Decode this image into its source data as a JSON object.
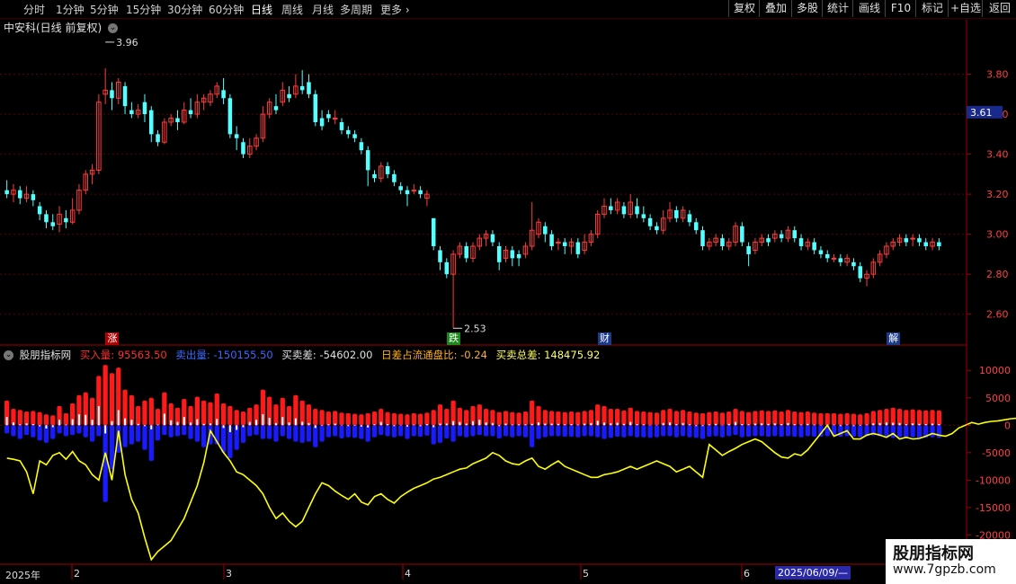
{
  "toolbar": {
    "periods": [
      "分时",
      "1分钟",
      "5分钟",
      "15分钟",
      "30分钟",
      "60分钟",
      "日线",
      "周线",
      "月线",
      "多周期",
      "更多"
    ],
    "active_period": "日线",
    "right_buttons": [
      "复权",
      "叠加",
      "多股",
      "统计",
      "画线",
      "F10",
      "标记",
      "+自选",
      "返回"
    ]
  },
  "chart_header": {
    "title": "中安科(日线 前复权)"
  },
  "price_axis": {
    "ticks": [
      "3.80",
      "3.60",
      "3.40",
      "3.20",
      "3.00",
      "2.80",
      "2.60"
    ],
    "current_price": "3.61"
  },
  "annotations": {
    "high": "3.96",
    "low": "2.53"
  },
  "event_labels": [
    {
      "text": "涨",
      "color": "#b00000",
      "index": 16
    },
    {
      "text": "跌",
      "color": "#1a8a1a",
      "index": 68
    },
    {
      "text": "财",
      "color": "#1a3a8a",
      "index": 91
    },
    {
      "text": "解",
      "color": "#1a3a8a",
      "index": 135
    }
  ],
  "indicator": {
    "name": "股朋指标网",
    "buy_label": "买入量: 95563.50",
    "sell_label": "卖出量: -150155.50",
    "diff_label": "买卖差: -54602.00",
    "ratio_label": "日差占流通盘比: -0.24",
    "total_label": "买卖总差: 148475.92",
    "axis_ticks": [
      "10000",
      "5000",
      "0",
      "-5000",
      "-10000",
      "-15000",
      "-20000"
    ]
  },
  "date_axis": {
    "labels": [
      "2025年",
      "2",
      "3",
      "4",
      "5",
      "6"
    ],
    "cursor_date": "2025/06/09/—"
  },
  "watermark": {
    "title": "股朋指标网",
    "url": "www.7gpzb.com"
  },
  "colors": {
    "up": "#ff3c3c",
    "down": "#54ffff",
    "buy": "#ff1a1a",
    "sell": "#1a1aff",
    "line": "#ffff00",
    "grid": "#5a0000"
  },
  "chart_data": {
    "type": "candlestick",
    "price_ylim": [
      2.5,
      4.0
    ],
    "indicator_ylim": [
      -25000,
      12000
    ],
    "candles": [
      [
        3.22,
        3.2,
        3.27,
        3.18,
        4500,
        -1500
      ],
      [
        3.2,
        3.22,
        3.25,
        3.16,
        3000,
        -2000
      ],
      [
        3.22,
        3.18,
        3.24,
        3.15,
        2800,
        -2500
      ],
      [
        3.18,
        3.2,
        3.24,
        3.16,
        2500,
        -1800
      ],
      [
        3.2,
        3.17,
        3.22,
        3.14,
        2600,
        -2200
      ],
      [
        3.14,
        3.1,
        3.16,
        3.07,
        2400,
        -2800
      ],
      [
        3.1,
        3.06,
        3.12,
        3.03,
        2000,
        -3200
      ],
      [
        3.06,
        3.04,
        3.1,
        3.02,
        1800,
        -2500
      ],
      [
        3.05,
        3.1,
        3.14,
        3.01,
        3500,
        -1500
      ],
      [
        3.08,
        3.06,
        3.12,
        3.03,
        2200,
        -2000
      ],
      [
        3.06,
        3.12,
        3.18,
        3.05,
        4000,
        -1800
      ],
      [
        3.12,
        3.22,
        3.25,
        3.1,
        5500,
        -1500
      ],
      [
        3.22,
        3.3,
        3.32,
        3.2,
        6000,
        -2200
      ],
      [
        3.3,
        3.32,
        3.35,
        3.25,
        5000,
        -3000
      ],
      [
        3.32,
        3.66,
        3.7,
        3.3,
        9000,
        -2000
      ],
      [
        3.7,
        3.72,
        3.83,
        3.65,
        11000,
        -14000
      ],
      [
        3.72,
        3.68,
        3.76,
        3.62,
        9500,
        -8000
      ],
      [
        3.68,
        3.76,
        3.78,
        3.65,
        10500,
        -5000
      ],
      [
        3.74,
        3.64,
        3.76,
        3.6,
        6500,
        -4000
      ],
      [
        3.62,
        3.6,
        3.66,
        3.58,
        5500,
        -3500
      ],
      [
        3.6,
        3.62,
        3.65,
        3.58,
        3500,
        -3000
      ],
      [
        3.66,
        3.6,
        3.7,
        3.56,
        4500,
        -4500
      ],
      [
        3.62,
        3.5,
        3.64,
        3.46,
        5000,
        -6500
      ],
      [
        3.5,
        3.46,
        3.52,
        3.44,
        3000,
        -2800
      ],
      [
        3.46,
        3.56,
        3.58,
        3.45,
        6000,
        -1800
      ],
      [
        3.56,
        3.58,
        3.6,
        3.54,
        4000,
        -2200
      ],
      [
        3.58,
        3.56,
        3.62,
        3.52,
        3200,
        -2000
      ],
      [
        3.56,
        3.62,
        3.66,
        3.55,
        4800,
        -1800
      ],
      [
        3.62,
        3.6,
        3.68,
        3.58,
        3500,
        -2500
      ],
      [
        3.6,
        3.66,
        3.7,
        3.58,
        5200,
        -3000
      ],
      [
        3.66,
        3.68,
        3.7,
        3.62,
        4500,
        -4000
      ],
      [
        3.66,
        3.7,
        3.72,
        3.64,
        4200,
        -3500
      ],
      [
        3.7,
        3.74,
        3.76,
        3.68,
        5800,
        -3500
      ],
      [
        3.72,
        3.68,
        3.78,
        3.65,
        4000,
        -5000
      ],
      [
        3.68,
        3.5,
        3.7,
        3.48,
        3500,
        -6000
      ],
      [
        3.5,
        3.48,
        3.54,
        3.42,
        2800,
        -4500
      ],
      [
        3.46,
        3.4,
        3.48,
        3.38,
        2500,
        -3200
      ],
      [
        3.4,
        3.44,
        3.48,
        3.38,
        3200,
        -2000
      ],
      [
        3.44,
        3.48,
        3.5,
        3.42,
        3800,
        -1800
      ],
      [
        3.48,
        3.6,
        3.64,
        3.46,
        6500,
        -2500
      ],
      [
        3.6,
        3.66,
        3.68,
        3.58,
        5200,
        -2500
      ],
      [
        3.64,
        3.62,
        3.7,
        3.6,
        3800,
        -3000
      ],
      [
        3.66,
        3.72,
        3.76,
        3.64,
        5000,
        -2000
      ],
      [
        3.7,
        3.68,
        3.74,
        3.66,
        3500,
        -2500
      ],
      [
        3.7,
        3.74,
        3.8,
        3.68,
        5500,
        -3000
      ],
      [
        3.74,
        3.72,
        3.82,
        3.7,
        4500,
        -3200
      ],
      [
        3.76,
        3.7,
        3.8,
        3.68,
        3800,
        -3000
      ],
      [
        3.7,
        3.56,
        3.72,
        3.54,
        3000,
        -4000
      ],
      [
        3.58,
        3.54,
        3.62,
        3.52,
        2800,
        -3000
      ],
      [
        3.6,
        3.58,
        3.62,
        3.56,
        2500,
        -2200
      ],
      [
        3.58,
        3.58,
        3.62,
        3.55,
        2600,
        -2000
      ],
      [
        3.56,
        3.52,
        3.58,
        3.5,
        2300,
        -2400
      ],
      [
        3.52,
        3.5,
        3.54,
        3.48,
        2200,
        -2200
      ],
      [
        3.5,
        3.48,
        3.52,
        3.46,
        2100,
        -2300
      ],
      [
        3.46,
        3.42,
        3.48,
        3.4,
        2000,
        -2500
      ],
      [
        3.42,
        3.32,
        3.44,
        3.24,
        2200,
        -3000
      ],
      [
        3.3,
        3.28,
        3.32,
        3.26,
        2500,
        -2200
      ],
      [
        3.28,
        3.34,
        3.36,
        3.26,
        3000,
        -1800
      ],
      [
        3.34,
        3.3,
        3.36,
        3.28,
        2400,
        -2000
      ],
      [
        3.3,
        3.26,
        3.32,
        3.24,
        2200,
        -2200
      ],
      [
        3.24,
        3.22,
        3.26,
        3.2,
        2100,
        -2000
      ],
      [
        3.22,
        3.2,
        3.24,
        3.14,
        2000,
        -2500
      ],
      [
        3.22,
        3.22,
        3.25,
        3.2,
        2200,
        -2000
      ],
      [
        3.22,
        3.2,
        3.24,
        3.18,
        2100,
        -2100
      ],
      [
        3.18,
        3.2,
        3.22,
        3.14,
        2300,
        -1900
      ],
      [
        3.08,
        2.94,
        3.08,
        2.92,
        2800,
        -3500
      ],
      [
        2.92,
        2.86,
        2.94,
        2.82,
        3800,
        -3200
      ],
      [
        2.86,
        2.8,
        2.88,
        2.78,
        3000,
        -2400
      ],
      [
        2.8,
        2.9,
        2.92,
        2.53,
        4500,
        -3000
      ],
      [
        2.9,
        2.94,
        2.96,
        2.88,
        3200,
        -2000
      ],
      [
        2.94,
        2.88,
        2.96,
        2.86,
        2800,
        -2200
      ],
      [
        2.88,
        2.94,
        2.96,
        2.86,
        3500,
        -2000
      ],
      [
        2.94,
        2.98,
        3.0,
        2.92,
        3800,
        -1800
      ],
      [
        2.98,
        3.0,
        3.02,
        2.94,
        3000,
        -2000
      ],
      [
        3.0,
        2.96,
        3.02,
        2.94,
        2800,
        -2000
      ],
      [
        2.94,
        2.86,
        2.96,
        2.82,
        2400,
        -2400
      ],
      [
        2.88,
        2.92,
        2.94,
        2.86,
        2600,
        -2000
      ],
      [
        2.92,
        2.88,
        2.94,
        2.84,
        2400,
        -2200
      ],
      [
        2.9,
        2.88,
        2.92,
        2.84,
        2300,
        -2000
      ],
      [
        2.9,
        2.94,
        2.96,
        2.88,
        2500,
        -2200
      ],
      [
        2.94,
        3.02,
        3.16,
        2.92,
        4500,
        -4000
      ],
      [
        3.0,
        3.06,
        3.08,
        2.98,
        3500,
        -2500
      ],
      [
        3.04,
        3.0,
        3.06,
        2.96,
        2800,
        -2200
      ],
      [
        3.0,
        2.94,
        3.02,
        2.92,
        2600,
        -2000
      ],
      [
        2.96,
        2.96,
        2.98,
        2.92,
        2500,
        -2000
      ],
      [
        2.96,
        2.94,
        2.98,
        2.9,
        2400,
        -2100
      ],
      [
        2.94,
        2.96,
        2.98,
        2.9,
        2500,
        -2100
      ],
      [
        2.96,
        2.9,
        2.98,
        2.88,
        2400,
        -2200
      ],
      [
        2.92,
        2.96,
        3.0,
        2.9,
        2600,
        -2000
      ],
      [
        2.96,
        3.0,
        3.02,
        2.94,
        2800,
        -2000
      ],
      [
        3.0,
        3.1,
        3.12,
        2.98,
        3800,
        -2200
      ],
      [
        3.1,
        3.14,
        3.18,
        3.08,
        3500,
        -2500
      ],
      [
        3.14,
        3.12,
        3.18,
        3.1,
        3000,
        -2300
      ],
      [
        3.12,
        3.16,
        3.18,
        3.1,
        3000,
        -2100
      ],
      [
        3.14,
        3.1,
        3.16,
        3.08,
        2700,
        -2200
      ],
      [
        3.1,
        3.16,
        3.2,
        3.08,
        3200,
        -2000
      ],
      [
        3.14,
        3.1,
        3.18,
        3.08,
        2600,
        -2200
      ],
      [
        3.1,
        3.08,
        3.14,
        3.06,
        2500,
        -2200
      ],
      [
        3.08,
        3.04,
        3.1,
        3.02,
        2400,
        -2300
      ],
      [
        3.04,
        3.02,
        3.06,
        3.0,
        2300,
        -2200
      ],
      [
        3.02,
        3.08,
        3.12,
        3.0,
        2800,
        -2000
      ],
      [
        3.08,
        3.12,
        3.16,
        3.06,
        3000,
        -2000
      ],
      [
        3.12,
        3.08,
        3.14,
        3.06,
        2600,
        -2200
      ],
      [
        3.08,
        3.12,
        3.14,
        3.06,
        2800,
        -2000
      ],
      [
        3.1,
        3.06,
        3.12,
        3.04,
        2500,
        -2200
      ],
      [
        3.06,
        3.02,
        3.08,
        3.0,
        2300,
        -2300
      ],
      [
        3.02,
        2.94,
        3.04,
        2.92,
        2200,
        -2500
      ],
      [
        2.94,
        2.96,
        2.98,
        2.92,
        2400,
        -2100
      ],
      [
        2.96,
        2.98,
        3.0,
        2.94,
        2500,
        -2000
      ],
      [
        2.98,
        2.94,
        3.0,
        2.92,
        2300,
        -2200
      ],
      [
        2.94,
        2.96,
        2.98,
        2.92,
        2500,
        -2000
      ],
      [
        2.96,
        3.04,
        3.06,
        2.94,
        3000,
        -1800
      ],
      [
        3.04,
        2.96,
        3.06,
        2.94,
        2600,
        -2200
      ],
      [
        2.94,
        2.9,
        2.96,
        2.84,
        2400,
        -2100
      ],
      [
        2.92,
        2.96,
        2.98,
        2.9,
        2600,
        -2000
      ],
      [
        2.96,
        2.98,
        3.0,
        2.94,
        2700,
        -2000
      ],
      [
        2.98,
        2.96,
        3.0,
        2.94,
        2600,
        -2100
      ],
      [
        2.98,
        3.0,
        3.02,
        2.96,
        2700,
        -2000
      ],
      [
        3.0,
        2.98,
        3.02,
        2.96,
        2500,
        -2100
      ],
      [
        2.98,
        3.02,
        3.04,
        2.96,
        2800,
        -2000
      ],
      [
        3.02,
        2.98,
        3.04,
        2.96,
        2500,
        -2100
      ],
      [
        2.98,
        2.94,
        3.0,
        2.92,
        2400,
        -2200
      ],
      [
        2.94,
        2.96,
        2.98,
        2.92,
        2500,
        -2000
      ],
      [
        2.96,
        2.92,
        2.98,
        2.9,
        2300,
        -2100
      ],
      [
        2.92,
        2.9,
        2.94,
        2.88,
        2200,
        -2100
      ],
      [
        2.9,
        2.88,
        2.92,
        2.86,
        2200,
        -2000
      ],
      [
        2.88,
        2.88,
        2.9,
        2.86,
        2200,
        -2000
      ],
      [
        2.88,
        2.86,
        2.9,
        2.84,
        2100,
        -2100
      ],
      [
        2.86,
        2.88,
        2.9,
        2.84,
        2200,
        -2000
      ],
      [
        2.86,
        2.84,
        2.88,
        2.82,
        2100,
        -2100
      ],
      [
        2.84,
        2.78,
        2.86,
        2.76,
        2000,
        -2200
      ],
      [
        2.78,
        2.8,
        2.82,
        2.74,
        2200,
        -2000
      ],
      [
        2.8,
        2.86,
        2.88,
        2.78,
        2600,
        -1900
      ],
      [
        2.86,
        2.9,
        2.92,
        2.84,
        2800,
        -2000
      ],
      [
        2.9,
        2.94,
        2.96,
        2.88,
        3000,
        -2000
      ],
      [
        2.94,
        2.96,
        2.98,
        2.92,
        3200,
        -2300
      ],
      [
        2.96,
        2.98,
        3.0,
        2.94,
        3000,
        -2200
      ],
      [
        2.98,
        2.96,
        3.0,
        2.94,
        2800,
        -2400
      ],
      [
        2.98,
        2.98,
        3.0,
        2.94,
        2900,
        -2200
      ],
      [
        2.98,
        2.96,
        3.0,
        2.94,
        2800,
        -2300
      ],
      [
        2.96,
        2.94,
        2.98,
        2.92,
        2700,
        -2300
      ],
      [
        2.94,
        2.96,
        2.98,
        2.92,
        2800,
        -2200
      ],
      [
        2.96,
        2.94,
        2.98,
        2.92,
        2700,
        -2300
      ]
    ],
    "diff_line": [
      -6000,
      -6200,
      -6500,
      -8500,
      -12500,
      -6500,
      -7200,
      -5500,
      -5000,
      -6200,
      -4800,
      -6500,
      -7200,
      -9000,
      -10000,
      -5000,
      -10000,
      -1000,
      -9000,
      -13500,
      -16000,
      -20500,
      -24500,
      -23000,
      -22000,
      -21000,
      -19000,
      -17000,
      -14000,
      -11000,
      -6800,
      -1000,
      -3000,
      -5000,
      -6500,
      -8500,
      -9000,
      -10000,
      -11000,
      -12500,
      -15000,
      -17000,
      -16000,
      -17500,
      -18500,
      -17500,
      -15000,
      -12500,
      -10500,
      -11000,
      -12000,
      -12800,
      -13500,
      -12500,
      -14000,
      -14500,
      -13000,
      -12500,
      -13500,
      -14200,
      -13000,
      -12200,
      -11500,
      -11000,
      -10500,
      -9800,
      -9500,
      -9000,
      -8500,
      -8000,
      -7800,
      -7000,
      -6500,
      -6000,
      -5000,
      -5500,
      -6500,
      -7000,
      -7200,
      -6500,
      -6000,
      -7500,
      -8000,
      -7200,
      -6500,
      -7500,
      -8000,
      -8500,
      -9000,
      -9500,
      -9500,
      -9000,
      -8800,
      -8500,
      -8000,
      -7500,
      -8000,
      -7500,
      -7000,
      -6500,
      -7000,
      -7500,
      -8500,
      -8000,
      -7500,
      -8500,
      -9500,
      -3500,
      -4500,
      -5500,
      -4800,
      -4200,
      -3500,
      -3000,
      -2500,
      -3000,
      -4000,
      -5000,
      -5800,
      -6000,
      -5200,
      -5500,
      -4500,
      -3000,
      -1500,
      0,
      -2000,
      -1500,
      -1000,
      -2500,
      -2500,
      -1800,
      -1500,
      -1800,
      -2200,
      -1500,
      -2500,
      -2200,
      -2500,
      -2400,
      -2000,
      -1500,
      -1800,
      -2000,
      -1500,
      -500,
      0,
      500,
      200,
      500,
      700,
      800,
      1000,
      1200,
      1300,
      1200
    ]
  }
}
